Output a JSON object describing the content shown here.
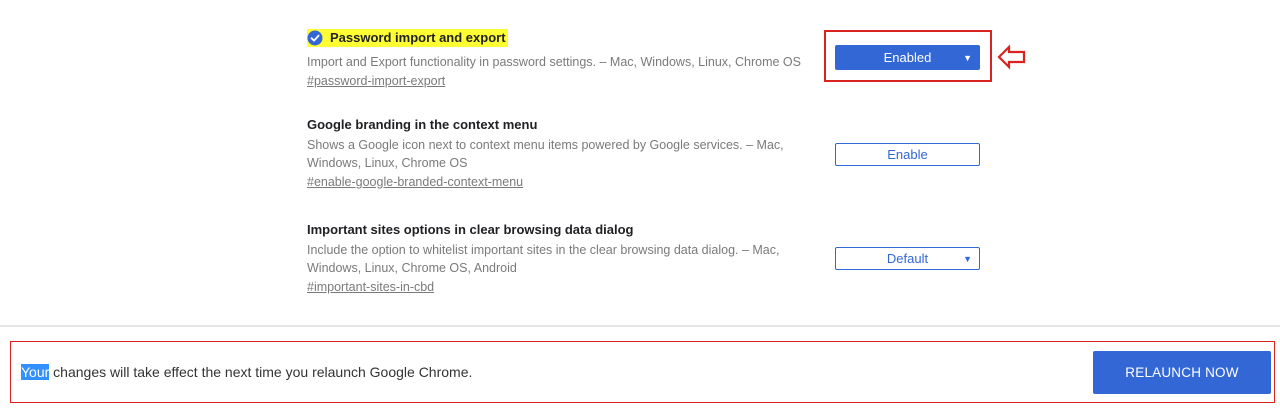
{
  "flags": [
    {
      "title": "Password import and export",
      "description": "Import and Export functionality in password settings.  – Mac, Windows, Linux, Chrome OS",
      "link": "#password-import-export",
      "control_label": "Enabled",
      "control_style": "dropdown-filled",
      "highlighted": true,
      "icon": "check-circle-icon"
    },
    {
      "title": "Google branding in the context menu",
      "description": "Shows a Google icon next to context menu items powered by Google services.  – Mac, Windows, Linux, Chrome OS",
      "link": "#enable-google-branded-context-menu",
      "control_label": "Enable",
      "control_style": "button-outline",
      "highlighted": false
    },
    {
      "title": "Important sites options in clear browsing data dialog",
      "description": "Include the option to whitelist important sites in the clear browsing data dialog.  – Mac, Windows, Linux, Chrome OS, Android",
      "link": "#important-sites-in-cbd",
      "control_label": "Default",
      "control_style": "dropdown-outline",
      "highlighted": false
    }
  ],
  "footer": {
    "selected_word": "Your",
    "message_rest": " changes will take effect the next time you relaunch Google Chrome.",
    "relaunch_label": "RELAUNCH NOW"
  },
  "colors": {
    "accent": "#3367d6",
    "highlight": "#ffff33",
    "annotation": "#d9231f",
    "text_secondary": "#7a7a7a",
    "selection": "#3390ff"
  }
}
